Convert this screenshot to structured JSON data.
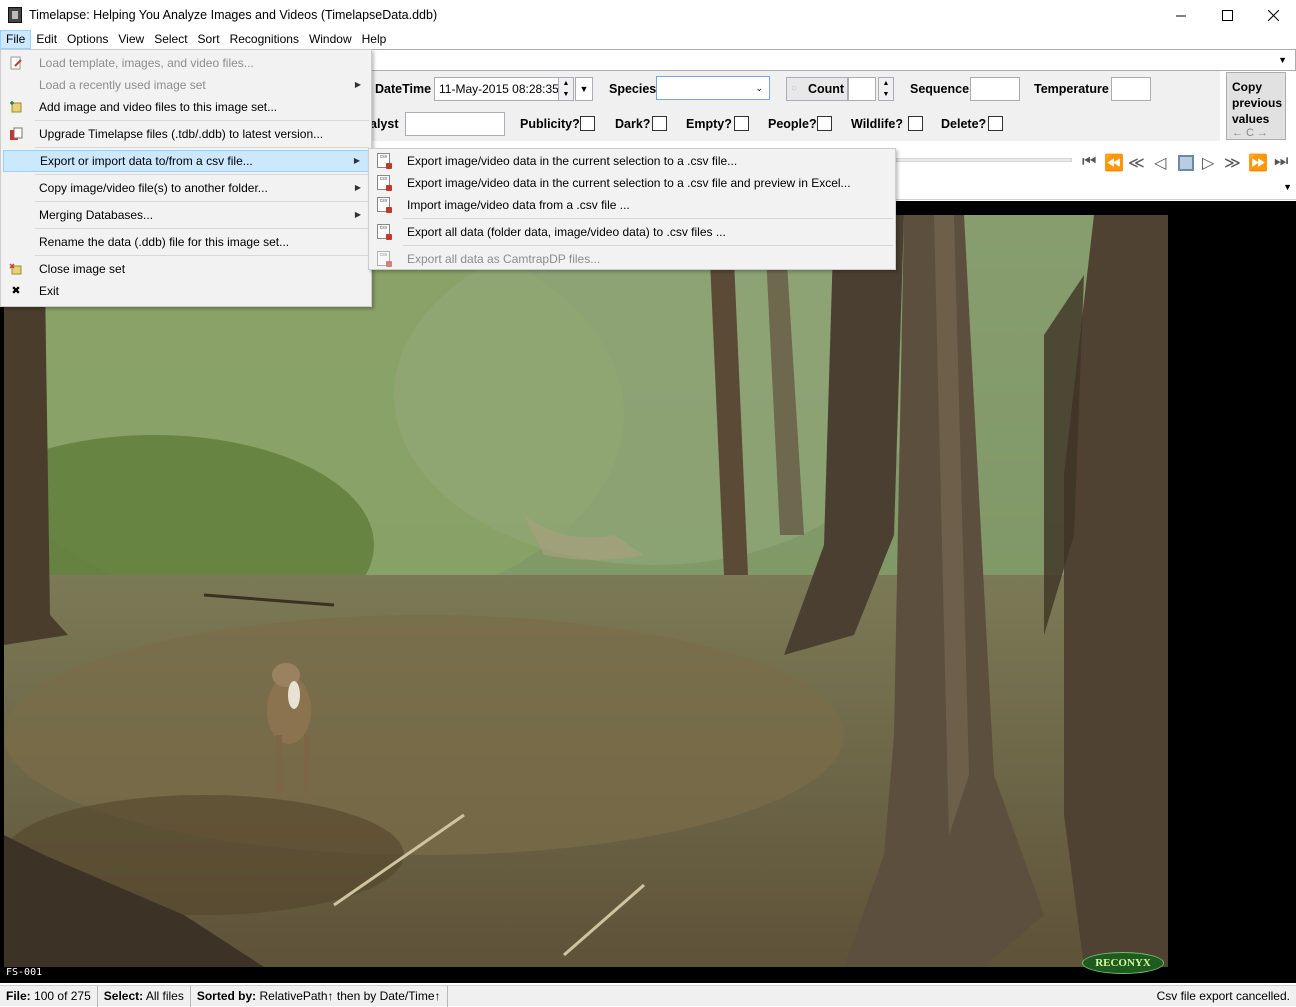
{
  "window": {
    "title": "Timelapse: Helping You Analyze Images and Videos (TimelapseData.ddb)"
  },
  "menubar": {
    "items": [
      "File",
      "Edit",
      "Options",
      "View",
      "Select",
      "Sort",
      "Recognitions",
      "Window",
      "Help"
    ]
  },
  "file_menu": {
    "items": [
      {
        "label": "Load template, images, and video files...",
        "disabled": true,
        "icon": "load-template-icon"
      },
      {
        "label": "Load a recently used image set",
        "disabled": true,
        "submenu": true
      },
      {
        "label": "Add image and video files to this image set...",
        "icon": "add-files-icon"
      },
      {
        "label": "Upgrade Timelapse files (.tdb/.ddb) to latest version...",
        "icon": "upgrade-icon"
      },
      {
        "label": "Export or import data to/from a csv file...",
        "submenu": true,
        "highlighted": true
      },
      {
        "label": "Copy image/video file(s) to another folder...",
        "submenu": true
      },
      {
        "label": "Merging Databases...",
        "submenu": true
      },
      {
        "label": "Rename the data (.ddb) file for this image set..."
      },
      {
        "label": "Close image set",
        "icon": "close-set-icon"
      },
      {
        "label": "Exit",
        "icon": "exit-icon"
      }
    ]
  },
  "csv_submenu": {
    "items": [
      {
        "label": "Export image/video data in the current selection to a .csv file..."
      },
      {
        "label": "Export image/video data in the current selection to a .csv file and preview in Excel..."
      },
      {
        "label": "Import image/video data from a .csv file ..."
      },
      {
        "label": "Export all data (folder data, image/video data) to .csv files ..."
      },
      {
        "label": "Export all data as CamtrapDP files...",
        "disabled": true
      }
    ]
  },
  "data_entry": {
    "datetime_label": "DateTime",
    "datetime_value": "11-May-2015 08:28:35",
    "species_label": "Species",
    "species_value": "",
    "count_label": "Count",
    "count_value": "",
    "sequence_label": "Sequence",
    "sequence_value": "",
    "temperature_label": "Temperature",
    "temperature_value": "",
    "analyst_label": "alyst",
    "analyst_value": "",
    "publicity_label": "Publicity?",
    "dark_label": "Dark?",
    "empty_label": "Empty?",
    "people_label": "People?",
    "wildlife_label": "Wildlife?",
    "delete_label": "Delete?",
    "copy_previous_label": "Copy previous values",
    "copy_previous_arrows": "← C →"
  },
  "image": {
    "id_overlay": "FS-001",
    "logo_text": "RECONYX"
  },
  "statusbar": {
    "file_label": "File:",
    "file_index": "100",
    "of_text": "of",
    "file_total": "275",
    "select_label": "Select:",
    "select_value": "All files",
    "sorted_label": "Sorted by:",
    "sorted_value": "RelativePath↑ then by Date/Time↑",
    "message": "Csv file export cancelled."
  },
  "colors": {
    "menu_highlight": "#cce8ff",
    "menu_bg": "#f2f2f2",
    "panel_bg": "#f0f0f0"
  }
}
